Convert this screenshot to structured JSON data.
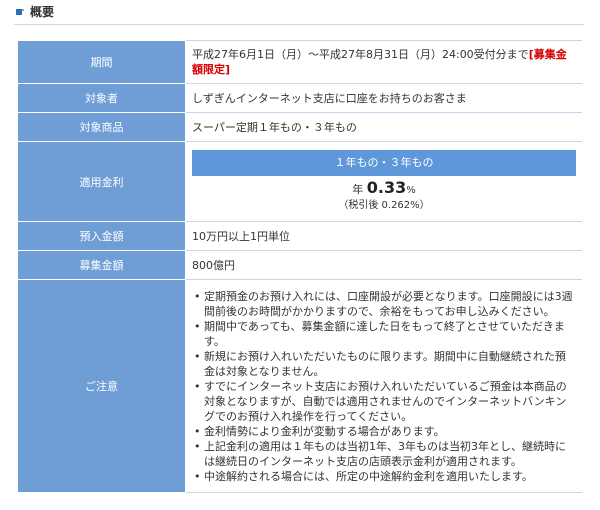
{
  "section": {
    "title": "概要"
  },
  "rows": {
    "period": {
      "label": "期間",
      "value": "平成27年6月1日（月）～平成27年8月31日（月）24:00受付分まで",
      "emphasis": "[募集金額限定]"
    },
    "target": {
      "label": "対象者",
      "value": "しずぎんインターネット支店に口座をお持ちのお客さま"
    },
    "product": {
      "label": "対象商品",
      "value": "スーパー定期１年もの・３年もの"
    },
    "rate": {
      "label": "適用金利",
      "header": "１年もの・３年もの",
      "prefix": "年",
      "value": "0.33",
      "unit": "%",
      "after_tax": "（税引後 0.262%）"
    },
    "deposit": {
      "label": "預入金額",
      "value": "10万円以上1円単位"
    },
    "amount": {
      "label": "募集金額",
      "value": "800億円"
    },
    "notes": {
      "label": "ご注意",
      "items": [
        "定期預金のお預け入れには、口座開設が必要となります。口座開設には3週間前後のお時間がかかりますので、余裕をもってお申し込みください。",
        "期間中であっても、募集金額に達した日をもって終了とさせていただきます。",
        "新規にお預け入れいただいたものに限ります。期間中に自動継続された預金は対象となりません。",
        "すでにインターネット支店にお預け入れいただいているご預金は本商品の対象となりますが、自動では適用されませんのでインターネットバンキングでのお預け入れ操作を行ってください。",
        "金利情勢により金利が変動する場合があります。",
        "上記金利の適用は１年ものは当初1年、3年ものは当初3年とし、継続時には継続日のインターネット支店の店頭表示金利が適用されます。",
        "中途解約される場合には、所定の中途解約金利を適用いたします。"
      ]
    }
  },
  "colors": {
    "header_bg": "#6f9ed6",
    "rate_head_bg": "#5f98da",
    "emphasis": "#d60000"
  }
}
